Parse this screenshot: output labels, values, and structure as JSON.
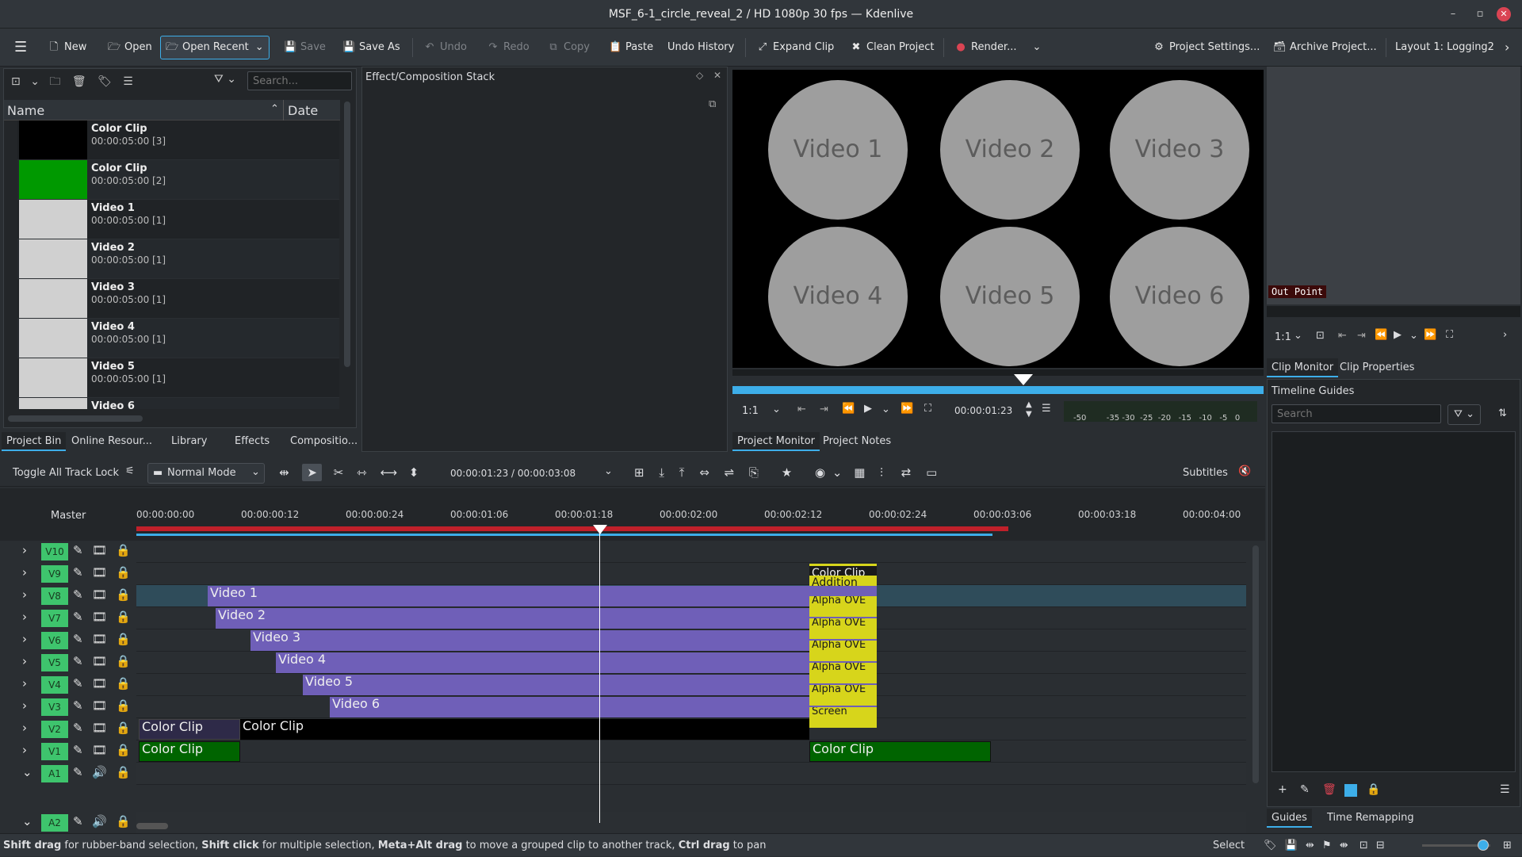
{
  "window": {
    "title": "MSF_6-1_circle_reveal_2 / HD 1080p 30 fps — Kdenlive"
  },
  "toolbar": {
    "new": "New",
    "open": "Open",
    "open_recent": "Open Recent",
    "save": "Save",
    "save_as": "Save As",
    "undo": "Undo",
    "redo": "Redo",
    "copy": "Copy",
    "paste": "Paste",
    "undo_history": "Undo History",
    "expand_clip": "Expand Clip",
    "clean_project": "Clean Project",
    "render": "Render...",
    "project_settings": "Project Settings...",
    "archive_project": "Archive Project...",
    "layout": "Layout 1: Logging2"
  },
  "bin": {
    "search_placeholder": "Search...",
    "col_name": "Name",
    "col_date": "Date",
    "items": [
      {
        "name": "Color Clip",
        "sub": "00:00:05:00 [3]",
        "color": "#000000"
      },
      {
        "name": "Color Clip",
        "sub": "00:00:05:00 [2]",
        "color": "#009900"
      },
      {
        "name": "Video 1",
        "sub": "00:00:05:00 [1]",
        "color": "#d0d0d0"
      },
      {
        "name": "Video 2",
        "sub": "00:00:05:00 [1]",
        "color": "#d0d0d0"
      },
      {
        "name": "Video 3",
        "sub": "00:00:05:00 [1]",
        "color": "#d0d0d0"
      },
      {
        "name": "Video 4",
        "sub": "00:00:05:00 [1]",
        "color": "#d0d0d0"
      },
      {
        "name": "Video 5",
        "sub": "00:00:05:00 [1]",
        "color": "#d0d0d0"
      },
      {
        "name": "Video 6",
        "sub": "",
        "color": "#d0d0d0"
      }
    ],
    "tabs": [
      "Project Bin",
      "Online Resour...",
      "Library",
      "Effects",
      "Compositio..."
    ]
  },
  "effect_stack": {
    "title": "Effect/Composition Stack"
  },
  "project_monitor": {
    "circles": [
      "Video 1",
      "Video 2",
      "Video 3",
      "Video 4",
      "Video 5",
      "Video 6"
    ],
    "zoom": "1:1",
    "timecode": "00:00:01:23",
    "audio_scale": [
      "-50",
      "-35",
      "-30",
      "-25",
      "-20",
      "-15",
      "-10",
      "-5",
      "0"
    ],
    "tabs": [
      "Project Monitor",
      "Project Notes"
    ]
  },
  "clip_monitor": {
    "out_point": "Out Point",
    "zoom": "1:1",
    "tabs": [
      "Clip Monitor",
      "Clip Properties"
    ]
  },
  "guides": {
    "title": "Timeline Guides",
    "search_placeholder": "Search",
    "tabs": [
      "Guides",
      "Time Remapping"
    ]
  },
  "timeline_toolbar": {
    "track_lock": "Toggle All Track Lock",
    "mode": "Normal Mode",
    "position": "00:00:01:23 / 00:00:03:08",
    "subtitles": "Subtitles"
  },
  "timeline": {
    "master": "Master",
    "ruler": [
      "00:00:00:00",
      "00:00:00:12",
      "00:00:00:24",
      "00:00:01:06",
      "00:00:01:18",
      "00:00:02:00",
      "00:00:02:12",
      "00:00:02:24",
      "00:00:03:06",
      "00:00:03:18",
      "00:00:04:00"
    ],
    "tracks": [
      "V10",
      "V9",
      "V8",
      "V7",
      "V6",
      "V5",
      "V4",
      "V3",
      "V2",
      "V1",
      "A1",
      "A2"
    ],
    "clips": {
      "v9_color": "Color Clip",
      "v9_add": "Addition",
      "v8": "Video 1",
      "v7": "Video 2",
      "v6": "Video 3",
      "v5": "Video 4",
      "v4": "Video 5",
      "v3": "Video 6",
      "alpha": "Alpha OVE",
      "screen": "Screen",
      "v2a": "Color Clip",
      "v2b": "Color Clip",
      "v1a": "Color Clip",
      "v1b": "Color Clip"
    }
  },
  "statusbar": {
    "hint_parts": [
      "Shift drag",
      " for rubber-band selection, ",
      "Shift click",
      " for multiple selection, ",
      "Meta+Alt drag",
      " to move a grouped clip to another track, ",
      "Ctrl drag",
      " to pan"
    ],
    "mode": "Select"
  },
  "colors": {
    "accent": "#3daee9",
    "track_name": "#3ec46d",
    "video_clip": "#6f5fb8",
    "composition": "#d7d51b",
    "green_clip": "#006400"
  }
}
